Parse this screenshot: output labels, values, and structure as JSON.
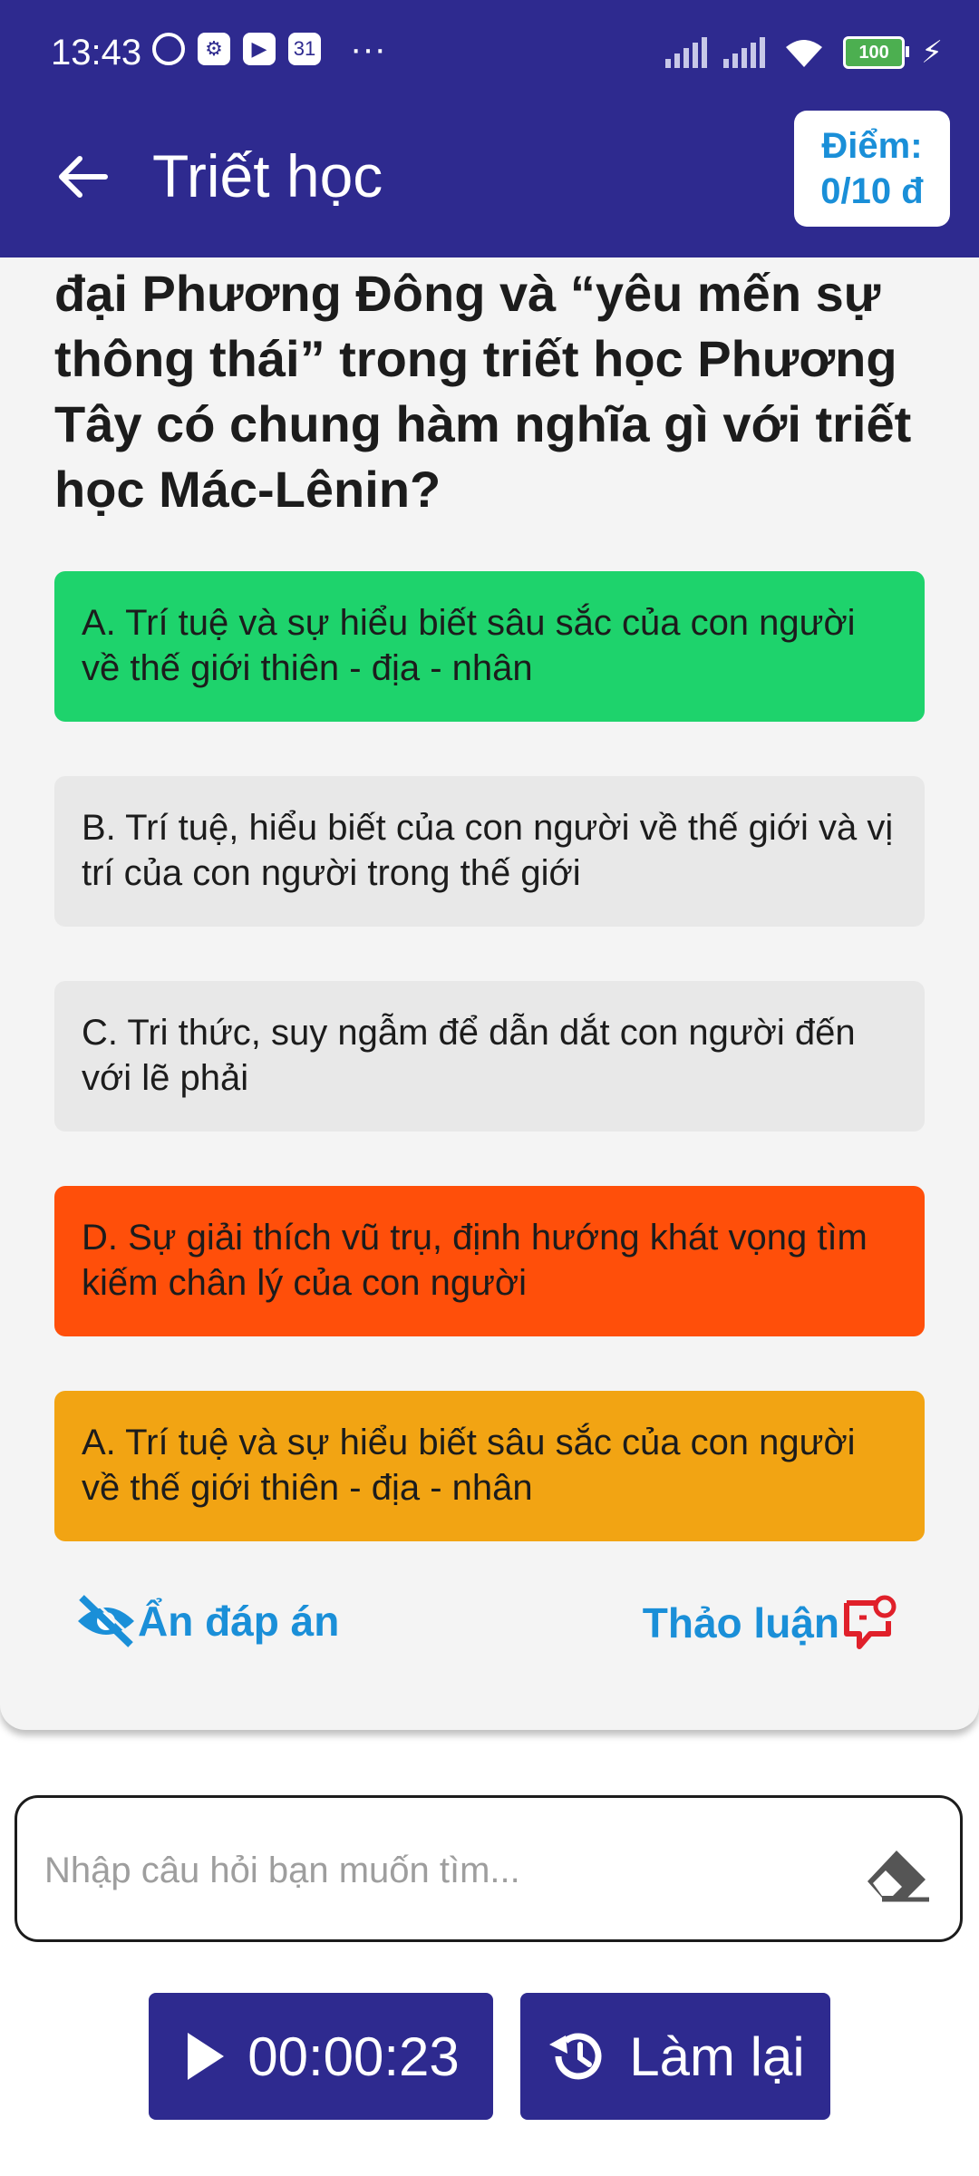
{
  "status": {
    "time": "13:43",
    "dots": "···",
    "battery": "100"
  },
  "header": {
    "title": "Triết học",
    "score_label": "Điểm:",
    "score_value": "0/10 đ"
  },
  "question": {
    "text": "đại Phương Đông và “yêu mến sự thông thái” trong triết học Phương Tây có chung hàm nghĩa gì với triết học Mác-Lênin?"
  },
  "options": [
    {
      "text": "A. Trí tuệ và sự hiểu biết sâu sắc của con người về thế giới thiên - địa - nhân",
      "color": "#1ed36c"
    },
    {
      "text": "B. Trí tuệ, hiểu biết của con người về thế giới và vị trí của con người trong thế giới",
      "color": "#e8e8e8"
    },
    {
      "text": "C. Tri thức, suy ngẫm để dẫn dắt con người đến với lẽ phải",
      "color": "#e8e8e8"
    },
    {
      "text": "D. Sự giải thích vũ trụ, định hướng khát vọng tìm kiếm chân lý của con người",
      "color": "#ff4f0a"
    }
  ],
  "answer": {
    "text": "A. Trí tuệ và sự hiểu biết sâu sắc của con người về thế giới thiên - địa - nhân",
    "color": "#f2a413"
  },
  "actions": {
    "hide_answer": "Ẩn đáp án",
    "discuss": "Thảo luận"
  },
  "search": {
    "placeholder": "Nhập câu hỏi bạn muốn tìm..."
  },
  "controls": {
    "timer": "00:00:23",
    "redo": "Làm lại"
  },
  "colors": {
    "primary": "#2e2a8f",
    "link": "#1a8fd8",
    "discuss_icon": "#e0202a"
  }
}
